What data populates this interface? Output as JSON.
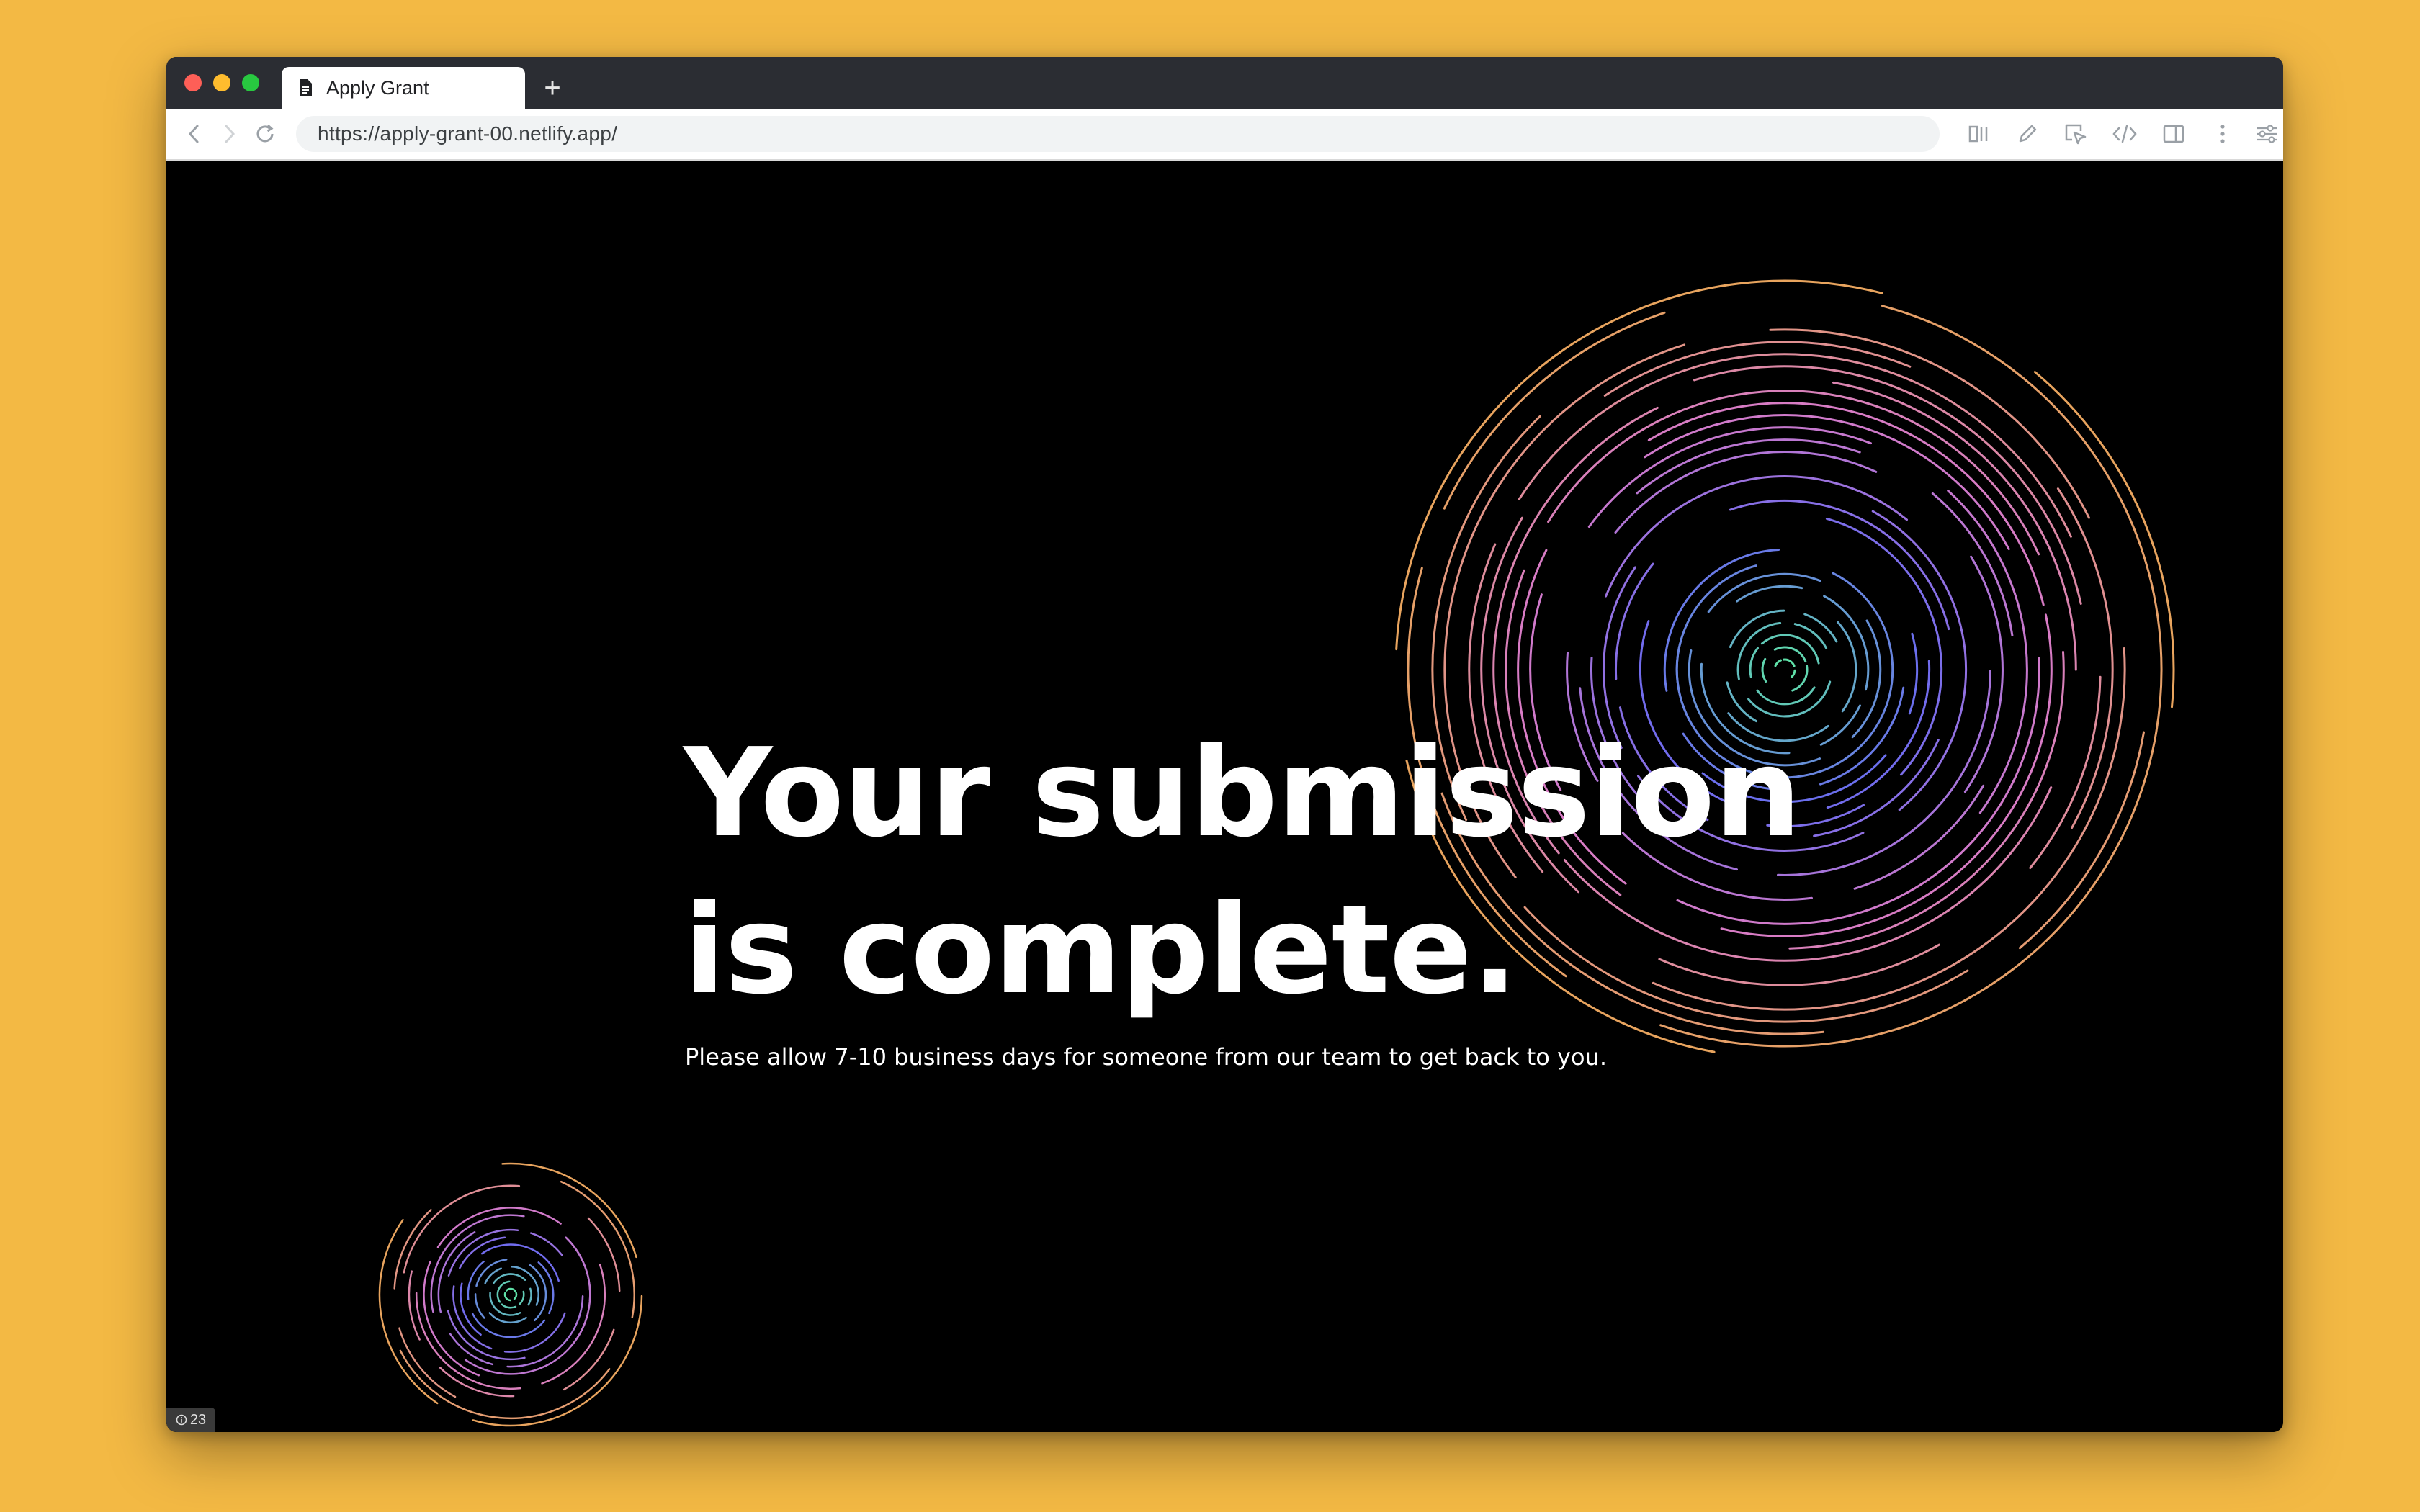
{
  "browser": {
    "tab_title": "Apply Grant",
    "new_tab_label": "+",
    "url": "https://apply-grant-00.netlify.app/",
    "icons": [
      "back-icon",
      "forward-icon",
      "reload-icon",
      "reader-icon",
      "pen-icon",
      "cursor-icon",
      "code-icon",
      "sidebar-icon",
      "more-icon",
      "settings-icon"
    ]
  },
  "page": {
    "headline_line1": "Your submission",
    "headline_line2": "is complete.",
    "subtext": "Please allow 7-10 business days for someone from our team to get back to you.",
    "badge_count": "23"
  },
  "colors": {
    "desktop": "#F3B944",
    "page_background": "#000000",
    "ring_inner": "#5FE0A8",
    "ring_mid": "#6B6BF0",
    "ring_outer": "#D77BC8",
    "ring_edge": "#E8A45E"
  }
}
